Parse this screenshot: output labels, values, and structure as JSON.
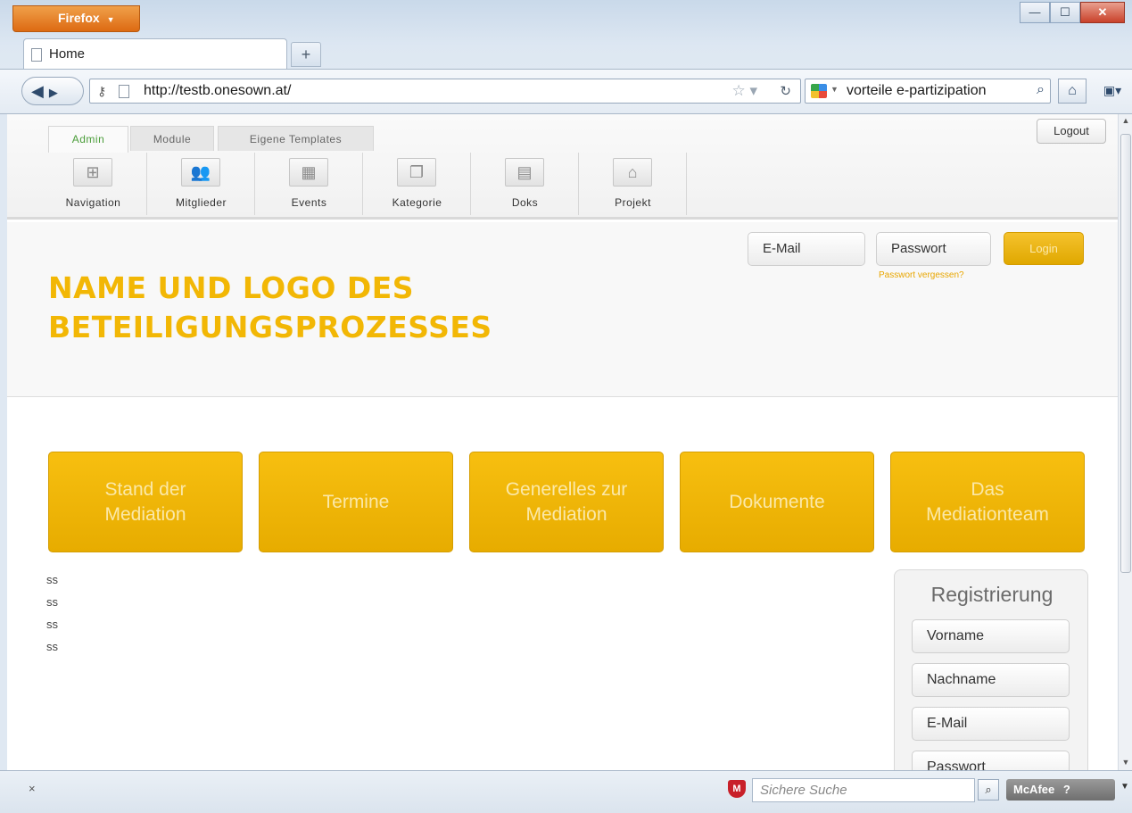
{
  "browser": {
    "app_button": "Firefox",
    "tab_title": "Home",
    "url": "http://testb.onesown.at/",
    "search_query": "vorteile e-partizipation",
    "status_search_placeholder": "Sichere Suche",
    "security_brand": "McAfee",
    "status_close": "×"
  },
  "admin": {
    "tabs": [
      {
        "label": "Admin"
      },
      {
        "label": "Module"
      },
      {
        "label": "Eigene Templates"
      }
    ],
    "logout_label": "Logout",
    "tools": [
      {
        "label": "Navigation",
        "icon": "sitemap-icon"
      },
      {
        "label": "Mitglieder",
        "icon": "members-icon"
      },
      {
        "label": "Events",
        "icon": "calendar-icon"
      },
      {
        "label": "Kategorie",
        "icon": "pages-icon"
      },
      {
        "label": "Doks",
        "icon": "document-icon"
      },
      {
        "label": "Projekt",
        "icon": "home-icon"
      }
    ]
  },
  "header": {
    "title_line1": "NAME UND LOGO DES",
    "title_line2": "BETEILIGUNGSPROZESSES",
    "email_placeholder": "E-Mail",
    "password_placeholder": "Passwort",
    "login_label": "Login",
    "forgot_password": "Passwort vergessen?"
  },
  "menu": [
    {
      "label": "Stand der Mediation"
    },
    {
      "label": "Termine"
    },
    {
      "label": "Generelles zur Mediation"
    },
    {
      "label": "Dokumente"
    },
    {
      "label": "Das Mediationteam"
    }
  ],
  "content": {
    "lines": [
      "ss",
      "ss",
      "ss",
      "ss"
    ]
  },
  "registration": {
    "title": "Registrierung",
    "fields": [
      "Vorname",
      "Nachname",
      "E-Mail",
      "Passwort"
    ]
  },
  "colors": {
    "accent": "#f2b705",
    "button_text": "#fbe8a8"
  }
}
